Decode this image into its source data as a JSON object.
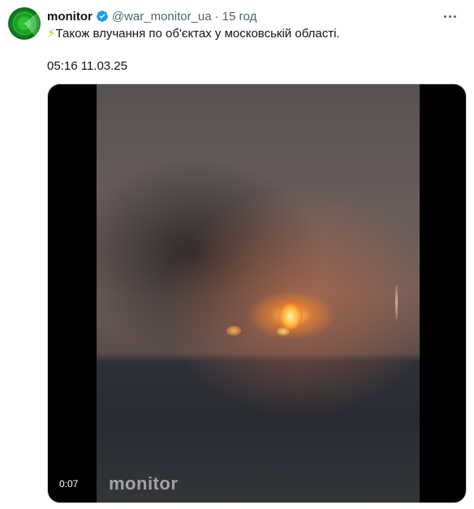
{
  "tweet": {
    "display_name": "monitor",
    "handle": "@war_monitor_ua",
    "separator": "·",
    "time_ago": "15 год",
    "text_emoji": "⚡",
    "text": "Також влучання по об'єктах у московській області.",
    "timestamp": "05:16 11.03.25",
    "verified_color": "#1d9bf0"
  },
  "media": {
    "type": "video",
    "duration": "0:07",
    "watermark": "monitor"
  }
}
